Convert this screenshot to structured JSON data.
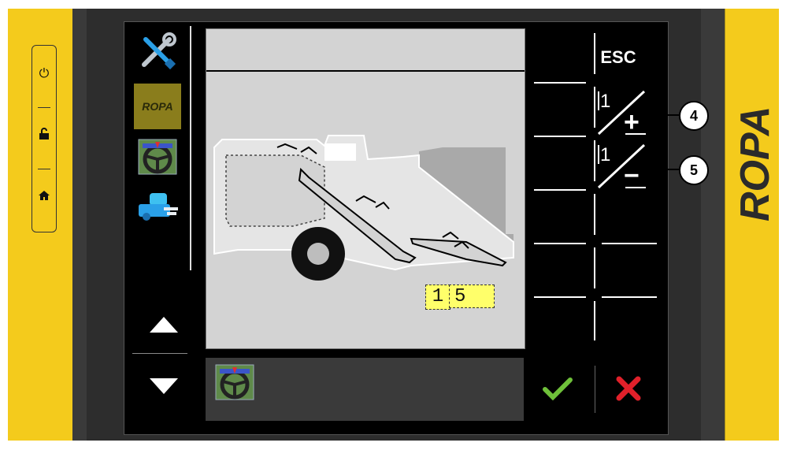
{
  "brand": {
    "name": "ROPA"
  },
  "keypad": {
    "keys": [
      {
        "name": "power-icon",
        "glyph": "⏻"
      },
      {
        "name": "unlock-icon",
        "glyph": "🔓"
      },
      {
        "name": "home-icon",
        "glyph": "⌂"
      }
    ]
  },
  "sidebar": {
    "ropa_tile_label": "ROPA",
    "up_arrow": "▲",
    "down_arrow": "▼"
  },
  "display": {
    "value_digits": [
      "1",
      "5"
    ]
  },
  "softkeys": {
    "esc_label": "ESC",
    "increment": {
      "step": "1",
      "sign": "+"
    },
    "decrement": {
      "step": "1",
      "sign": "−"
    }
  },
  "footer": {
    "confirm_glyph": "✔",
    "cancel_glyph": "✖"
  },
  "callouts": [
    "4",
    "5"
  ],
  "colors": {
    "bezel_yellow": "#f4cb1c",
    "screen_bg": "#000000",
    "machine_grey": "#d3d3d3",
    "value_box": "#ffff6a",
    "confirm_green": "#6fc13a",
    "cancel_red": "#e0202a"
  }
}
